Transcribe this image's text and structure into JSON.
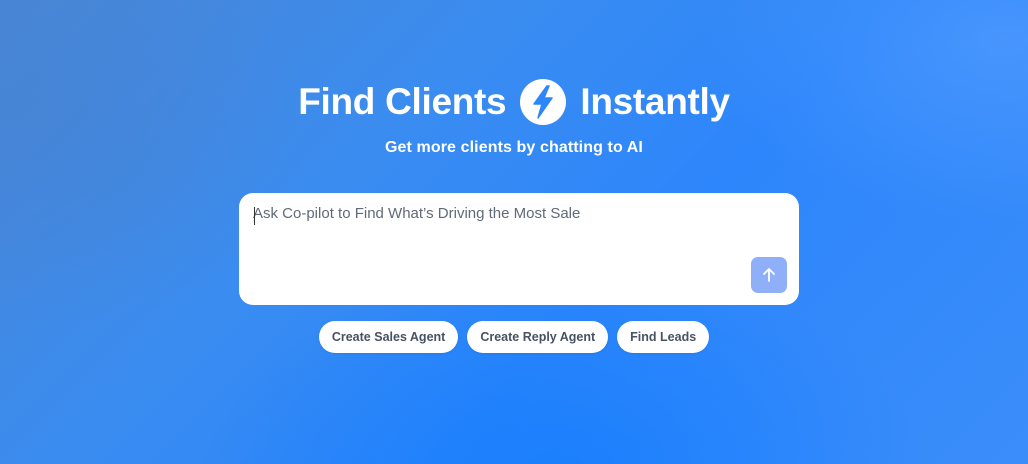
{
  "hero": {
    "title_left": "Find Clients",
    "title_right": "Instantly",
    "subtitle": "Get more clients by chatting to AI",
    "badge_icon": "lightning-bolt-icon"
  },
  "prompt": {
    "placeholder": "Ask Co-pilot to Find What’s Driving the Most Sale",
    "value": "",
    "send_icon": "arrow-up-icon"
  },
  "chips": [
    {
      "label": "Create Sales Agent"
    },
    {
      "label": "Create Reply Agent"
    },
    {
      "label": "Find Leads"
    }
  ],
  "colors": {
    "accent": "#2d86fb",
    "send_button": "#8fb0f9",
    "chip_text": "#475264"
  }
}
